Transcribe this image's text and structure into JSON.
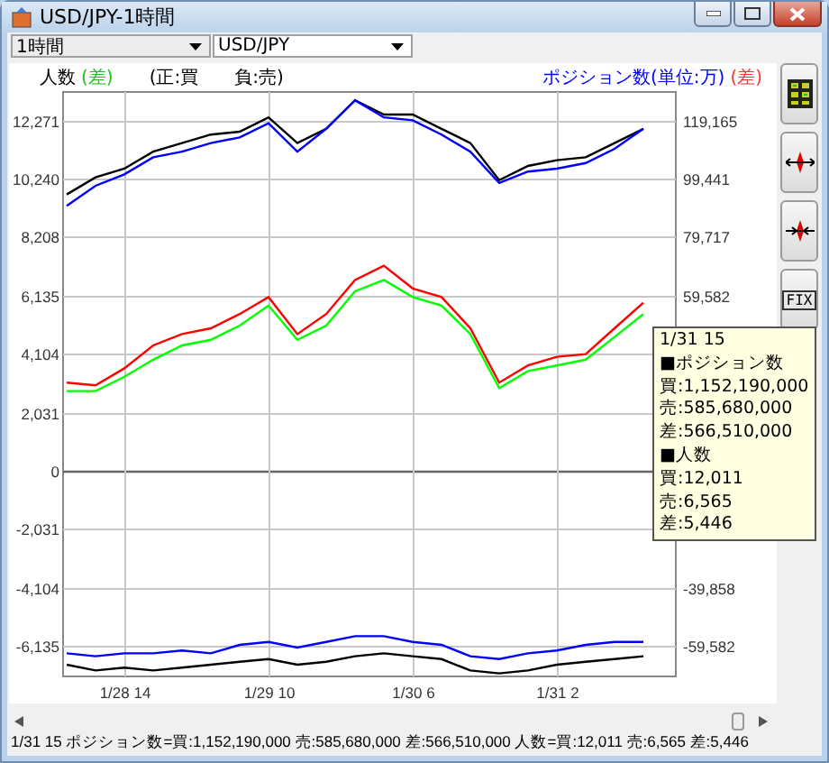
{
  "window": {
    "title": "USD/JPY-1時間"
  },
  "toolbar": {
    "period": {
      "value": "1時間"
    },
    "pair": {
      "value": "USD/JPY"
    }
  },
  "legend": {
    "left_label": "人数",
    "left_diff": "(差)",
    "note_buy": "(正:買",
    "note_sell": "負:売)",
    "right_label": "ポジション数(単位:万)",
    "right_diff": "(差)"
  },
  "chart": {
    "chart_data": {
      "type": "line",
      "categories": [
        null,
        null,
        "1/28 14",
        null,
        null,
        null,
        null,
        "1/29 10",
        null,
        null,
        null,
        null,
        "1/30 6",
        null,
        null,
        null,
        null,
        "1/31 2",
        null,
        null,
        null
      ],
      "series": [
        {
          "color": "#000000",
          "values": [
            9700,
            10300,
            10600,
            11200,
            11500,
            11800,
            11900,
            12400,
            11500,
            12000,
            13000,
            12500,
            12500,
            12000,
            11500,
            10200,
            10700,
            10900,
            11000,
            11500,
            12000
          ]
        },
        {
          "color": "#0000ff",
          "values": [
            9300,
            10000,
            10400,
            11000,
            11200,
            11500,
            11700,
            12200,
            11200,
            12000,
            13000,
            12400,
            12300,
            11800,
            11200,
            10100,
            10500,
            10600,
            10800,
            11300,
            12000
          ]
        },
        {
          "color": "#ff0000",
          "values": [
            3100,
            3000,
            3600,
            4400,
            4800,
            5000,
            5500,
            6100,
            4800,
            5500,
            6700,
            7200,
            6400,
            6100,
            5000,
            3100,
            3700,
            4000,
            4100,
            5000,
            5900
          ]
        },
        {
          "color": "#00ff00",
          "values": [
            2800,
            2800,
            3300,
            3900,
            4400,
            4600,
            5100,
            5800,
            4600,
            5100,
            6300,
            6700,
            6100,
            5800,
            4800,
            2900,
            3500,
            3700,
            3900,
            4700,
            5500
          ]
        },
        {
          "color": "#0000ff",
          "values": [
            -6400,
            -6500,
            -6400,
            -6400,
            -6300,
            -6400,
            -6100,
            -6000,
            -6200,
            -6000,
            -5800,
            -5800,
            -6000,
            -6100,
            -6500,
            -6600,
            -6400,
            -6300,
            -6100,
            -6000,
            -6000
          ]
        },
        {
          "color": "#000000",
          "values": [
            -6800,
            -7000,
            -6900,
            -7000,
            -6900,
            -6800,
            -6700,
            -6600,
            -6800,
            -6700,
            -6500,
            -6400,
            -6500,
            -6600,
            -7000,
            -7100,
            -7000,
            -6800,
            -6700,
            -6600,
            -6500
          ]
        }
      ],
      "grid": true,
      "ylim": [
        -7210,
        13292
      ],
      "y2lim": [
        -70016,
        129079
      ],
      "yticks": [
        {
          "value": 12271,
          "label": "12,271"
        },
        {
          "value": 10240,
          "label": "10,240"
        },
        {
          "value": 8208,
          "label": "8,208"
        },
        {
          "value": 6135,
          "label": "6,135"
        },
        {
          "value": 4104,
          "label": "4,104"
        },
        {
          "value": 2031,
          "label": "2,031"
        },
        {
          "value": 0,
          "label": "0"
        },
        {
          "value": -2031,
          "label": "-2,031"
        },
        {
          "value": -4104,
          "label": "-4,104"
        },
        {
          "value": -6135,
          "label": "-6,135"
        }
      ],
      "y2ticks": [
        {
          "value": 119165,
          "label": "119,165"
        },
        {
          "value": 99441,
          "label": "99,441"
        },
        {
          "value": 79717,
          "label": "79,717"
        },
        {
          "value": 59582,
          "label": "59,582"
        },
        {
          "value": -39858,
          "label": "-39,858"
        },
        {
          "value": -59582,
          "label": "-59,582"
        }
      ]
    },
    "tooltip": {
      "lines": [
        "1/31 15",
        "■ポジション数",
        "買:1,152,190,000",
        "売:585,680,000",
        "差:566,510,000",
        "■人数",
        "買:12,011",
        "売:6,565",
        "差:5,446"
      ]
    }
  },
  "sidebar": {
    "buttons": [
      {
        "kind": "display"
      },
      {
        "kind": "expand"
      },
      {
        "kind": "shrink"
      },
      {
        "kind": "fix",
        "label": "FIX"
      }
    ]
  },
  "status_bar": {
    "text": "1/31 15  ポジション数=買:1,152,190,000 売:585,680,000 差:566,510,000 人数=買:12,011 売:6,565 差:5,446"
  }
}
